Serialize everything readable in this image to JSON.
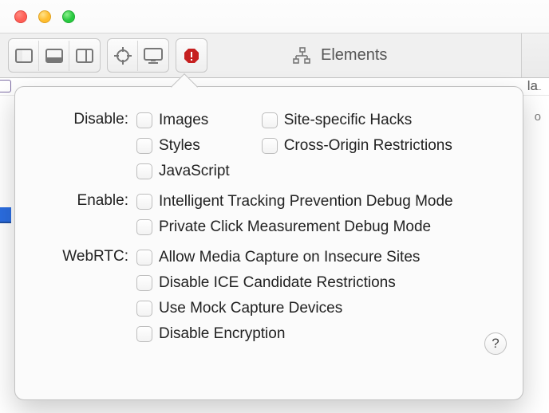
{
  "tab_label": "Elements",
  "background_fragments": {
    "right_top": "la",
    "blue_left": "",
    "cursor": "_",
    "o": "o"
  },
  "popover": {
    "groups": [
      {
        "label": "Disable:",
        "columns": [
          [
            "Images",
            "Styles",
            "JavaScript"
          ],
          [
            "Site-specific Hacks",
            "Cross-Origin Restrictions"
          ]
        ]
      },
      {
        "label": "Enable:",
        "items": [
          "Intelligent Tracking Prevention Debug Mode",
          "Private Click Measurement Debug Mode"
        ]
      },
      {
        "label": "WebRTC:",
        "items": [
          "Allow Media Capture on Insecure Sites",
          "Disable ICE Candidate Restrictions",
          "Use Mock Capture Devices",
          "Disable Encryption"
        ]
      }
    ],
    "help": "?"
  }
}
